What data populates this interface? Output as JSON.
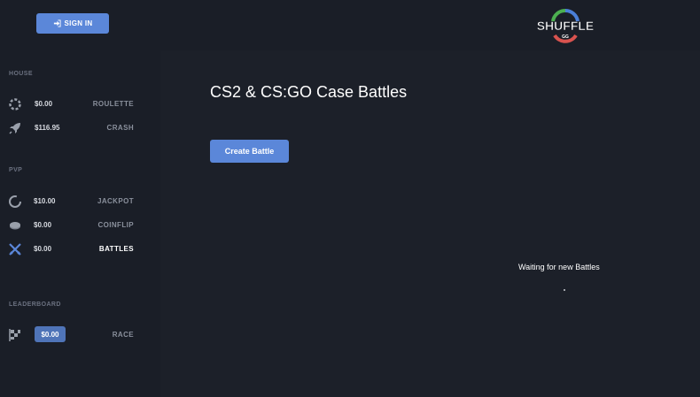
{
  "header": {
    "sign_in_label": "SIGN IN",
    "logo_text": "SHUFFLE",
    "logo_subtext": "GG"
  },
  "sidebar": {
    "sections": [
      {
        "label": "HOUSE"
      },
      {
        "label": "PVP"
      },
      {
        "label": "LEADERBOARD"
      }
    ],
    "items": [
      {
        "amount": "$0.00",
        "label": "ROULETTE",
        "icon": "roulette-icon"
      },
      {
        "amount": "$116.95",
        "label": "CRASH",
        "icon": "rocket-icon"
      },
      {
        "amount": "$10.00",
        "label": "JACKPOT",
        "icon": "jackpot-ring-icon"
      },
      {
        "amount": "$0.00",
        "label": "COINFLIP",
        "icon": "coin-icon"
      },
      {
        "amount": "$0.00",
        "label": "BATTLES",
        "icon": "crossed-swords-icon",
        "active": true
      },
      {
        "amount": "$0.00",
        "label": "RACE",
        "icon": "checkered-flag-icon"
      }
    ]
  },
  "main": {
    "title": "CS2 & CS:GO Case Battles",
    "create_button_label": "Create Battle",
    "empty_state": "Waiting for new Battles"
  },
  "colors": {
    "accent": "#5b87d9",
    "background": "#1c2029",
    "sidebar": "#1a1e27"
  }
}
